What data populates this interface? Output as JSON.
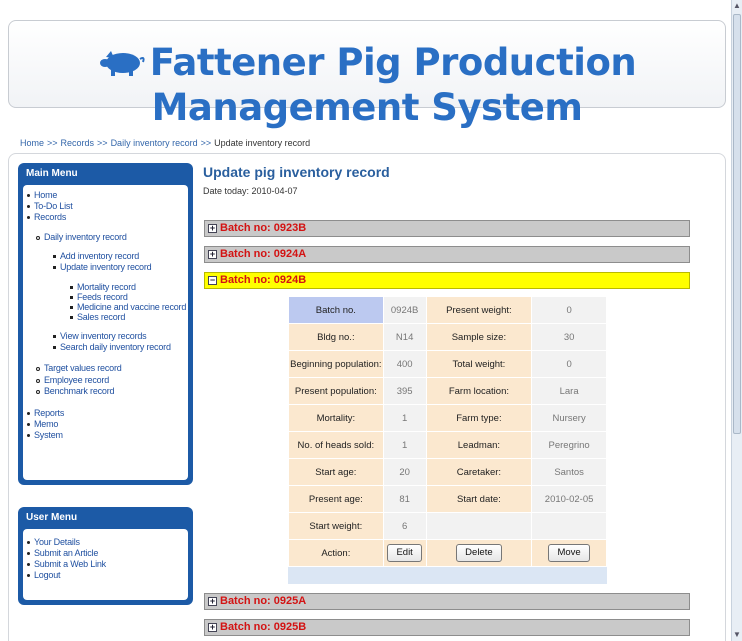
{
  "header": {
    "title": "Fattener Pig Production Management System",
    "logo_icon": "pig-icon"
  },
  "breadcrumb": {
    "items": [
      "Home",
      "Records",
      "Daily inventory record",
      "Update inventory record"
    ],
    "separator": ">>"
  },
  "main_menu": {
    "title": "Main Menu",
    "items": {
      "home": "Home",
      "todo": "To-Do List",
      "records": "Records",
      "daily_inventory": "Daily inventory record",
      "add_inventory": "Add inventory record",
      "update_inventory": "Update inventory record",
      "mortality": "Mortality record",
      "feeds": "Feeds record",
      "medicine": "Medicine and vaccine record",
      "sales": "Sales record",
      "view_inventory": "View inventory records",
      "search_daily": "Search daily inventory record",
      "target_values": "Target values record",
      "employee": "Employee record",
      "benchmark": "Benchmark record",
      "reports": "Reports",
      "memo": "Memo",
      "system": "System"
    }
  },
  "user_menu": {
    "title": "User Menu",
    "items": {
      "details": "Your Details",
      "article": "Submit an Article",
      "weblink": "Submit a Web Link",
      "logout": "Logout"
    }
  },
  "main": {
    "title": "Update pig inventory record",
    "date_today": "Date today: 2010-04-07",
    "batches": [
      {
        "label": "Batch no: 0923B",
        "expander": "+"
      },
      {
        "label": "Batch no: 0924A",
        "expander": "+"
      },
      {
        "label": "Batch no: 0924B",
        "expander": "−"
      },
      {
        "label": "Batch no: 0925A",
        "expander": "+"
      },
      {
        "label": "Batch no: 0925B",
        "expander": "+"
      }
    ]
  },
  "detail": {
    "batch_no_label": "Batch no.",
    "batch_no": "0924B",
    "present_weight_label": "Present weight:",
    "present_weight": "0",
    "bldg_label": "Bldg no.:",
    "bldg": "N14",
    "sample_size_label": "Sample size:",
    "sample_size": "30",
    "beginning_pop_label": "Beginning population:",
    "beginning_pop": "400",
    "total_weight_label": "Total weight:",
    "total_weight": "0",
    "present_pop_label": "Present population:",
    "present_pop": "395",
    "farm_location_label": "Farm location:",
    "farm_location": "Lara",
    "mortality_label": "Mortality:",
    "mortality": "1",
    "farm_type_label": "Farm type:",
    "farm_type": "Nursery",
    "heads_sold_label": "No. of heads sold:",
    "heads_sold": "1",
    "leadman_label": "Leadman:",
    "leadman": "Peregrino",
    "start_age_label": "Start age:",
    "start_age": "20",
    "caretaker_label": "Caretaker:",
    "caretaker": "Santos",
    "present_age_label": "Present age:",
    "present_age": "81",
    "start_date_label": "Start date:",
    "start_date": "2010-02-05",
    "start_weight_label": "Start weight:",
    "start_weight": "6",
    "action_label": "Action:",
    "edit_label": "Edit",
    "delete_label": "Delete",
    "move_label": "Move"
  },
  "colors": {
    "brand_blue": "#1c5aa6",
    "title_blue": "#2a6fc4",
    "batch_red": "#d31313",
    "open_yellow": "#ffff00"
  }
}
